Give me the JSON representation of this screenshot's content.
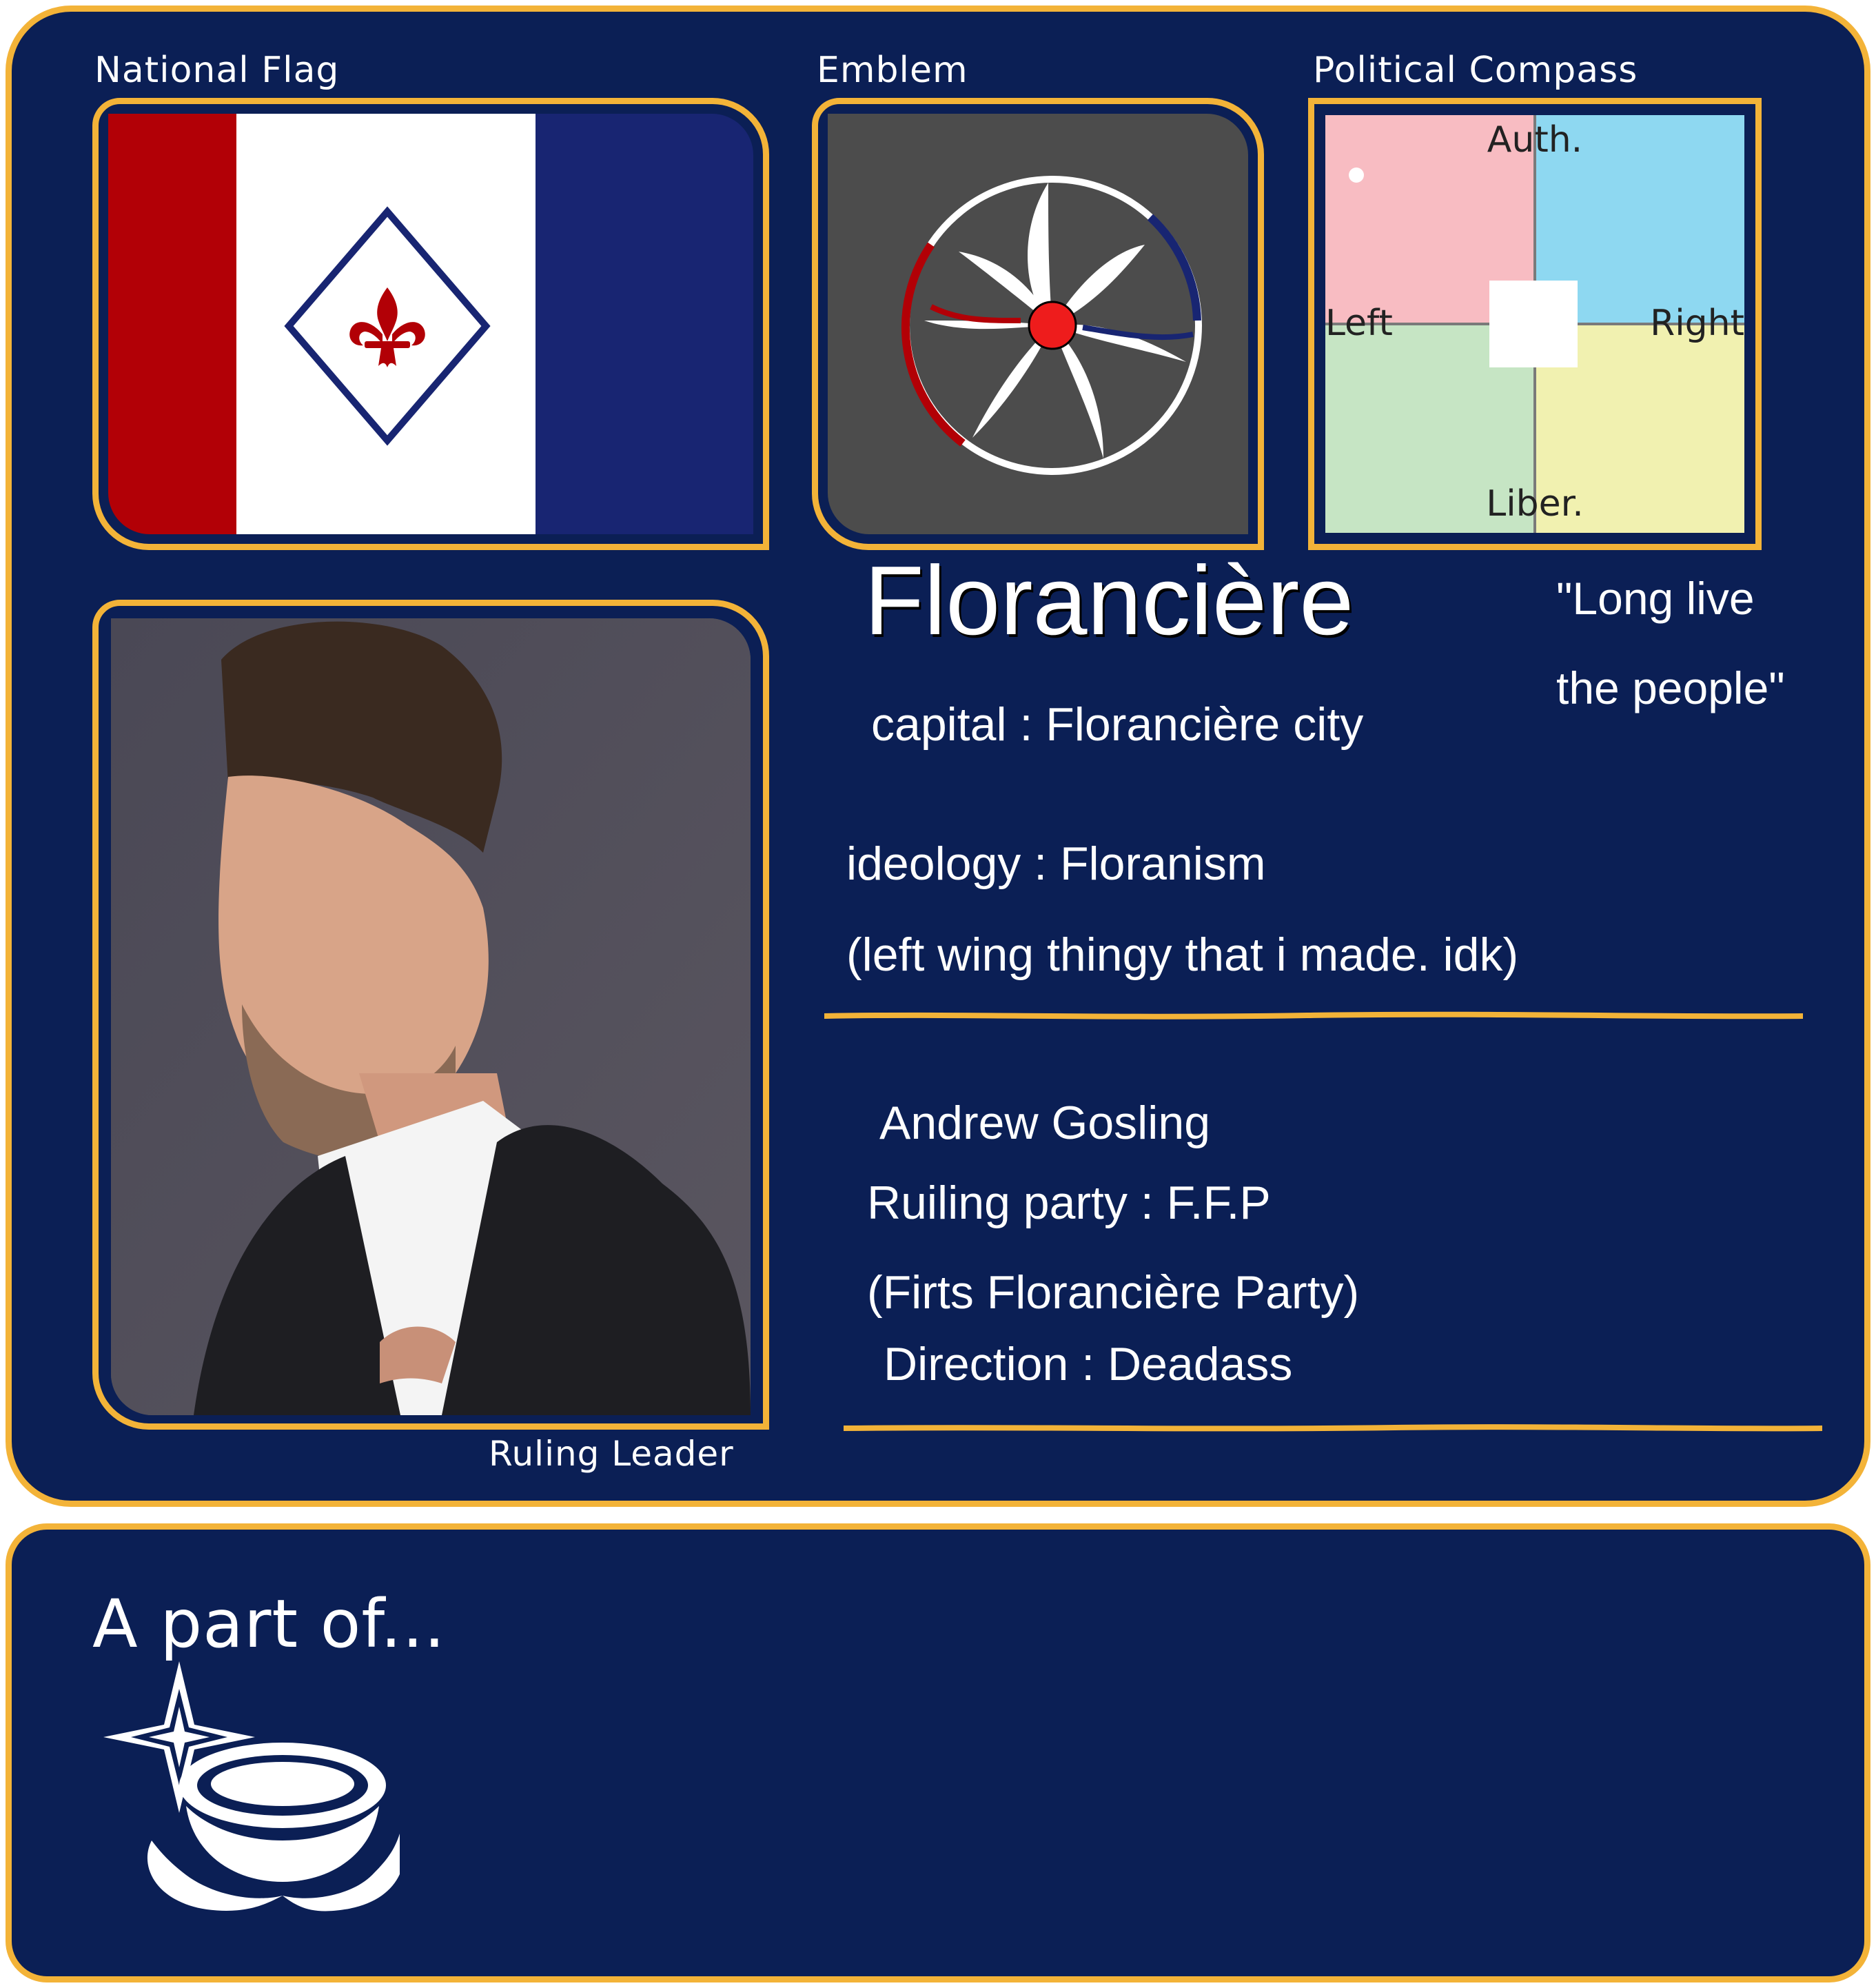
{
  "labels": {
    "flag": "National Flag",
    "emblem": "Emblem",
    "compass": "Political Compass",
    "leader": "Ruling Leader",
    "part_of": "A part of..."
  },
  "compass": {
    "top": "Auth.",
    "bottom": "Liber.",
    "left": "Left",
    "right": "Right",
    "colors": {
      "auth_left": "#f8bcc2",
      "auth_right": "#8ed8f1",
      "lib_left": "#c6e5c4",
      "lib_right": "#f1f1b0"
    }
  },
  "country": {
    "name": "Florancière",
    "motto_line1": "\"Long live",
    "motto_line2": "the people\"",
    "capital": "capital : Florancière city",
    "ideology": "ideology : Floranism",
    "ideology_note": "(left wing thingy that i made. idk)"
  },
  "leader": {
    "name": "Andrew Gosling",
    "party": "Ruiling party : F.F.P",
    "party_full": "(Firts Florancière Party)",
    "direction": "Direction : Deadass"
  },
  "colors": {
    "navy": "#0b1f55",
    "gold": "#f3b338",
    "flag_red": "#b20006",
    "flag_blue": "#182572",
    "emblem_bg": "#4c4c4c"
  }
}
